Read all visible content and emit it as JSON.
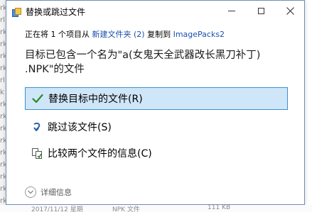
{
  "background": {
    "left_letters": [
      "rk",
      "rl",
      "rk",
      "rk",
      "rk",
      "rk",
      "rl",
      "k",
      "rk",
      "rk",
      "rk",
      "rk",
      "rk",
      "rk",
      "rk",
      "rk",
      "rk"
    ],
    "bottom_row": {
      "date": "2017/11/12 星期",
      "type": "NPK 文件",
      "size": "111 KB"
    }
  },
  "dialog": {
    "title": "替换或跳过文件",
    "path": {
      "prefix": "正在将 1 个项目从 ",
      "source": "新建文件夹 (2)",
      "middle": " 复制到 ",
      "dest": "ImagePacks2"
    },
    "message_line1": "目标已包含一个名为\"a(女鬼天全武器改长黑刀补丁)",
    "message_line2": ".NPK\"的文件",
    "options": {
      "replace": "替换目标中的文件(R)",
      "skip": "跳过该文件(S)",
      "compare": "比较两个文件的信息(C)"
    },
    "details": "详细信息"
  },
  "colors": {
    "selected_bg": "#cfe6f8",
    "selected_border": "#3b8fd6",
    "link": "#1a4fb0",
    "check": "#2b8a2b"
  },
  "icons": {
    "app": "file-replace-icon",
    "replace": "checkmark-icon",
    "skip": "skip-arrow-icon",
    "compare": "compare-files-icon",
    "details": "chevron-down-icon"
  }
}
